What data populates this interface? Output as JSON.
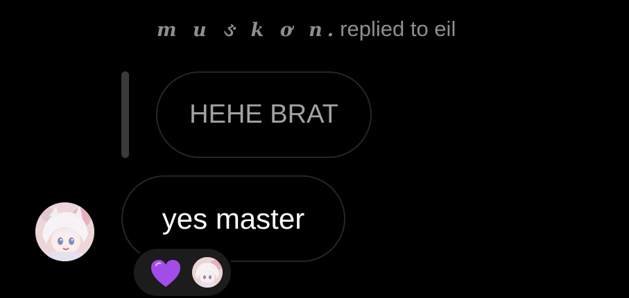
{
  "reply_header": {
    "sender_name": "m u ઙ k ơ n.",
    "replied_text": "replied to eil"
  },
  "quoted_message": {
    "text": "HEHE BRAT"
  },
  "message": {
    "text": "yes master"
  },
  "reactions": {
    "emoji": "purple-heart-icon",
    "count_shown": 1
  },
  "colors": {
    "background": "#000000",
    "muted_text": "#8e8e8e",
    "bubble_border": "#262626",
    "reaction_pill": "#1c1c1c",
    "heart": "#a34de8"
  }
}
